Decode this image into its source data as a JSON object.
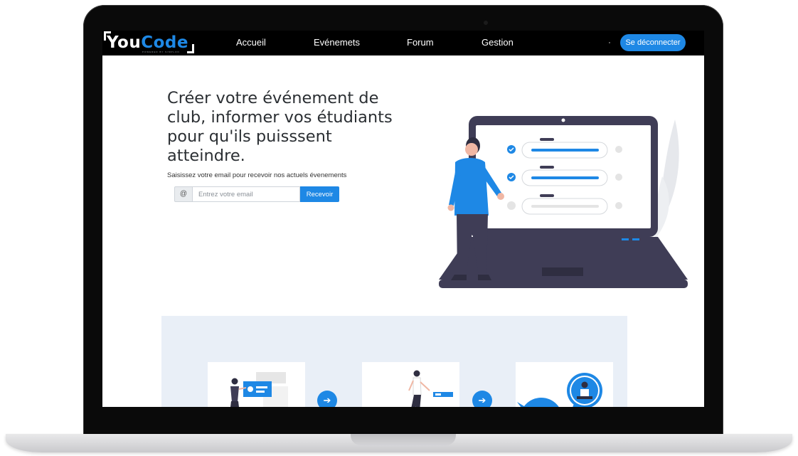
{
  "brand": {
    "logo_part1": "You",
    "logo_part2": "Code",
    "logo_tagline": "POWERED BY SIMPLON",
    "accent_color": "#1e88e5"
  },
  "nav": {
    "links": [
      "Accueil",
      "Evénemets",
      "Forum",
      "Gestion"
    ],
    "logout_label": "Se déconnecter"
  },
  "hero": {
    "title": "Créer votre événement de club, informer vos étudiants pour qu'ils puisssent atteindre.",
    "subtitle": "Saisissez votre email pour recevoir nos actuels évenements",
    "input_prefix": "@",
    "email_placeholder": "Entrez votre email",
    "submit_label": "Recevoir"
  },
  "illustration": {
    "icons": [
      "laptop-checklist-illustration",
      "person-pointing-icon",
      "checkmark-icon"
    ]
  },
  "steps": {
    "icons": [
      "person-presentation-icon",
      "person-walking-icon",
      "chat-bubbles-icon",
      "arrow-right-icon"
    ]
  }
}
